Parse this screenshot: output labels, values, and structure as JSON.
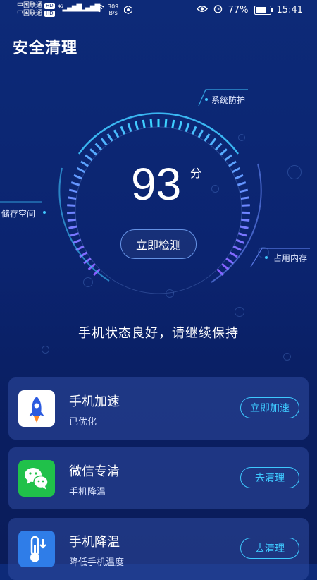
{
  "status_bar": {
    "carrier1": "中国联通",
    "carrier2": "中国联通",
    "hd": "HD",
    "net1": "4G",
    "net2": "4G",
    "speed_value": "309",
    "speed_unit": "B/s",
    "battery": "77%",
    "battery_level": 0.77,
    "time": "15:41"
  },
  "header": {
    "title": "安全清理"
  },
  "gauge": {
    "score": "93",
    "unit": "分",
    "check_button": "立即检测",
    "labels": {
      "protect": "系统防护",
      "storage": "储存空间",
      "memory": "占用内存"
    }
  },
  "status_message": "手机状态良好，请继续保持",
  "cards": [
    {
      "title": "手机加速",
      "subtitle": "已优化",
      "button": "立即加速",
      "icon": "rocket-icon"
    },
    {
      "title": "微信专清",
      "subtitle": "手机降温",
      "button": "去清理",
      "icon": "wechat-icon"
    },
    {
      "title": "手机降温",
      "subtitle": "降低手机温度",
      "button": "去清理",
      "icon": "thermometer-icon"
    }
  ],
  "colors": {
    "accent": "#3ec9ff",
    "background": "#0b2470",
    "gauge_start": "#39d7ff",
    "gauge_end": "#8a5cff"
  }
}
